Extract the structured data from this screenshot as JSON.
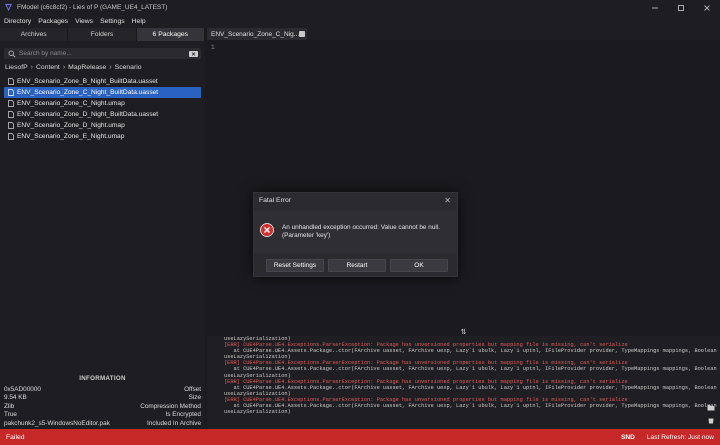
{
  "window": {
    "title": "FModel (c6c8cf2) - Lies of P (GAME_UE4_LATEST)",
    "controls": [
      "minimize",
      "maximize",
      "close"
    ]
  },
  "menu": [
    "Directory",
    "Packages",
    "Views",
    "Settings",
    "Help"
  ],
  "left_panel": {
    "tabs": [
      {
        "label": "Archives",
        "active": false
      },
      {
        "label": "Folders",
        "active": false
      },
      {
        "label": "6 Packages",
        "active": true
      }
    ],
    "search": {
      "placeholder": "Search by name...",
      "value": ""
    },
    "breadcrumb": [
      "LiesofP",
      "Content",
      "MapRelease",
      "Scenario"
    ],
    "files": [
      {
        "name": "ENV_Scenario_Zone_B_Night_BuiltData.uasset",
        "selected": false
      },
      {
        "name": "ENV_Scenario_Zone_C_Night_BuiltData.uasset",
        "selected": true
      },
      {
        "name": "ENV_Scenario_Zone_C_Night.umap",
        "selected": false
      },
      {
        "name": "ENV_Scenario_Zone_D_Night_BuiltData.uasset",
        "selected": false
      },
      {
        "name": "ENV_Scenario_Zone_D_Night.umap",
        "selected": false
      },
      {
        "name": "ENV_Scenario_Zone_E_Night.umap",
        "selected": false
      }
    ],
    "info": {
      "header": "INFORMATION",
      "rows": [
        {
          "value": "0x5AD00000",
          "label": "Offset"
        },
        {
          "value": "9.54 KB",
          "label": "Size"
        },
        {
          "value": "Zlib",
          "label": "Compression Method"
        },
        {
          "value": "True",
          "label": "Is Encrypted"
        },
        {
          "value": "pakchunk2_s5-WindowsNoEditor.pak",
          "label": "Included In Archive"
        }
      ]
    }
  },
  "editor": {
    "tab_label": "ENV_Scenario_Zone_C_Nig...",
    "line_number": "1"
  },
  "log": [
    "useLazySerialization)",
    "[ERR] CUE4Parse.UE4.Exceptions.ParserException: Package has unversioned properties but mapping file is missing, can't serialize",
    "   at CUE4Parse.UE4.Assets.Package..ctor(FArchive uasset, FArchive uexp, Lazy`1 ubulk, Lazy`1 uptnl, IFileProvider provider, TypeMappings mappings, Boolean",
    "useLazySerialization)",
    "[ERR] CUE4Parse.UE4.Exceptions.ParserException: Package has unversioned properties but mapping file is missing, can't serialize",
    "   at CUE4Parse.UE4.Assets.Package..ctor(FArchive uasset, FArchive uexp, Lazy`1 ubulk, Lazy`1 uptnl, IFileProvider provider, TypeMappings mappings, Boolean",
    "useLazySerialization)",
    "[ERR] CUE4Parse.UE4.Exceptions.ParserException: Package has unversioned properties but mapping file is missing, can't serialize",
    "   at CUE4Parse.UE4.Assets.Package..ctor(FArchive uasset, FArchive uexp, Lazy`1 ubulk, Lazy`1 uptnl, IFileProvider provider, TypeMappings mappings, Boolean",
    "useLazySerialization)",
    "[ERR] CUE4Parse.UE4.Exceptions.ParserException: Package has unversioned properties but mapping file is missing, can't serialize",
    "   at CUE4Parse.UE4.Assets.Package..ctor(FArchive uasset, FArchive uexp, Lazy`1 ubulk, Lazy`1 uptnl, IFileProvider provider, TypeMappings mappings, Boolean",
    "useLazySerialization)"
  ],
  "dialog": {
    "title": "Fatal Error",
    "message_line1": "An unhandled exception occurred: Value cannot be null.",
    "message_line2": "(Parameter 'key')",
    "buttons": {
      "reset": "Reset Settings",
      "restart": "Restart",
      "ok": "OK"
    }
  },
  "status": {
    "text": "Failed",
    "badge": "SND",
    "last_refresh": "Last Refresh: Just now",
    "color": "#c62828"
  },
  "colors": {
    "accent": "#2a62c2",
    "error": "#e05a5a",
    "status": "#c62828"
  }
}
